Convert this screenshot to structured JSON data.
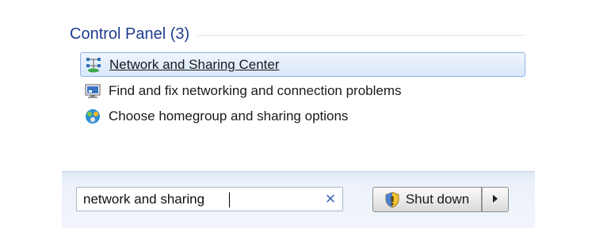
{
  "results": {
    "group_title": "Control Panel (3)",
    "items": [
      {
        "label": "Network and Sharing Center",
        "icon": "network-sharing-center-icon",
        "selected": true
      },
      {
        "label": "Find and fix networking and connection problems",
        "icon": "network-troubleshoot-icon",
        "selected": false
      },
      {
        "label": "Choose homegroup and sharing options",
        "icon": "homegroup-icon",
        "selected": false
      }
    ]
  },
  "search": {
    "value": "network and sharing",
    "clear_glyph": "✕"
  },
  "power": {
    "shutdown_label": "Shut down",
    "shield_icon": "uac-shield-icon",
    "arrow_glyph": "▶"
  },
  "colors": {
    "group_title": "#1e3d8f",
    "selection_border": "#8fb3e6",
    "clear_icon": "#3f6fb8"
  }
}
